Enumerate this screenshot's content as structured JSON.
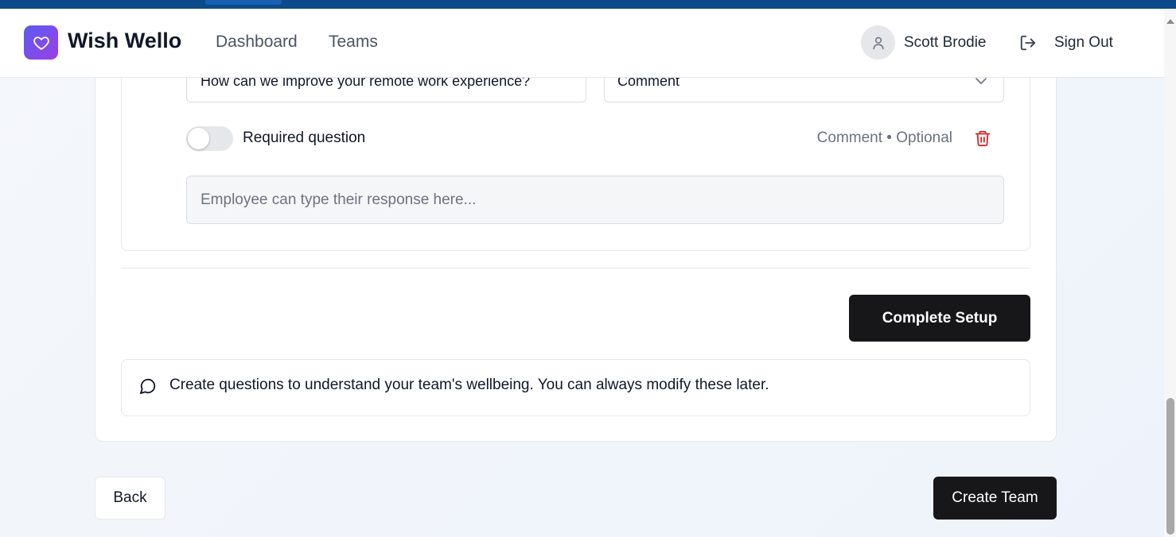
{
  "header": {
    "app_name": "Wish Wello",
    "nav": {
      "dashboard": "Dashboard",
      "teams": "Teams"
    },
    "user_name": "Scott Brodie",
    "sign_out": "Sign Out",
    "logo_icon": "heart-icon",
    "accent_gradient": [
      "#5b5cf0",
      "#9b3ee6"
    ]
  },
  "question": {
    "text": "How can we improve your remote work experience?",
    "type": "Comment",
    "required_label": "Required question",
    "required": false,
    "meta": "Comment • Optional",
    "response_placeholder": "Employee can type their response here..."
  },
  "actions": {
    "complete_setup": "Complete Setup",
    "back": "Back",
    "create_team": "Create Team"
  },
  "info": {
    "text": "Create questions to understand your team's wellbeing. You can always modify these later."
  },
  "colors": {
    "primary_button": "#17171a",
    "delete_icon": "#dc2626",
    "browser_bar": "#0d4a8a"
  }
}
